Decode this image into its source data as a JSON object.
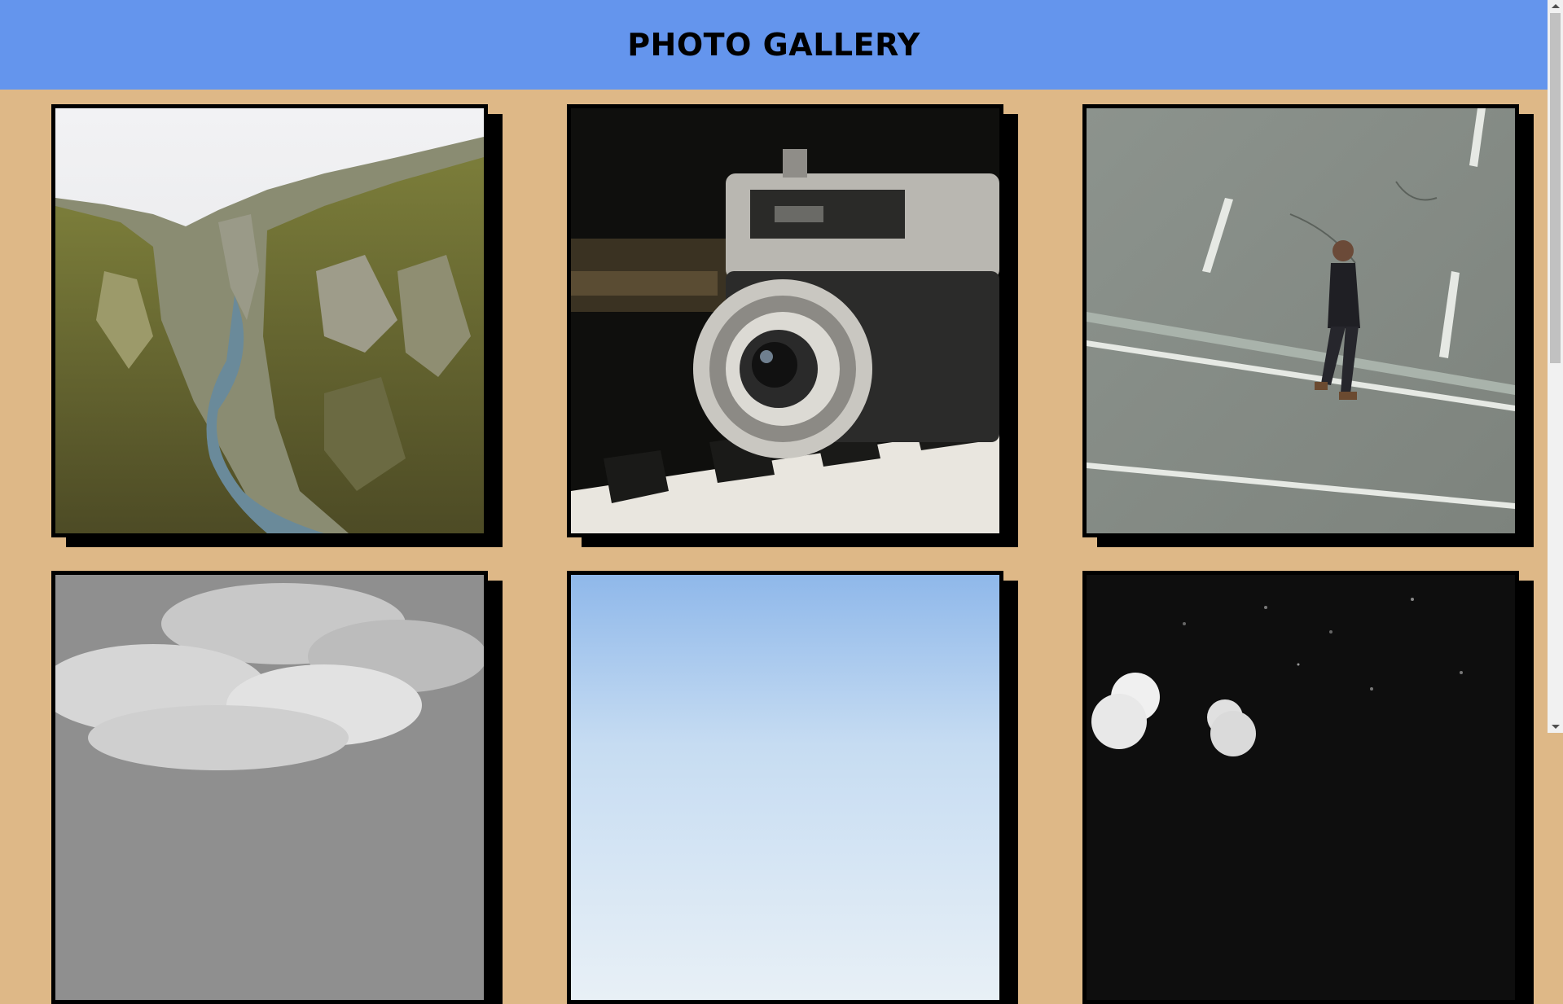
{
  "header": {
    "title": "PHOTO GALLERY",
    "background": "#6495ed"
  },
  "page": {
    "background": "#deb887"
  },
  "gallery": {
    "photos": [
      {
        "icon": "canyon-landscape-photo"
      },
      {
        "icon": "vintage-camera-photo"
      },
      {
        "icon": "man-walking-street-photo"
      },
      {
        "icon": "clouds-monochrome-photo"
      },
      {
        "icon": "blue-sky-photo"
      },
      {
        "icon": "dark-bokeh-photo"
      }
    ]
  }
}
